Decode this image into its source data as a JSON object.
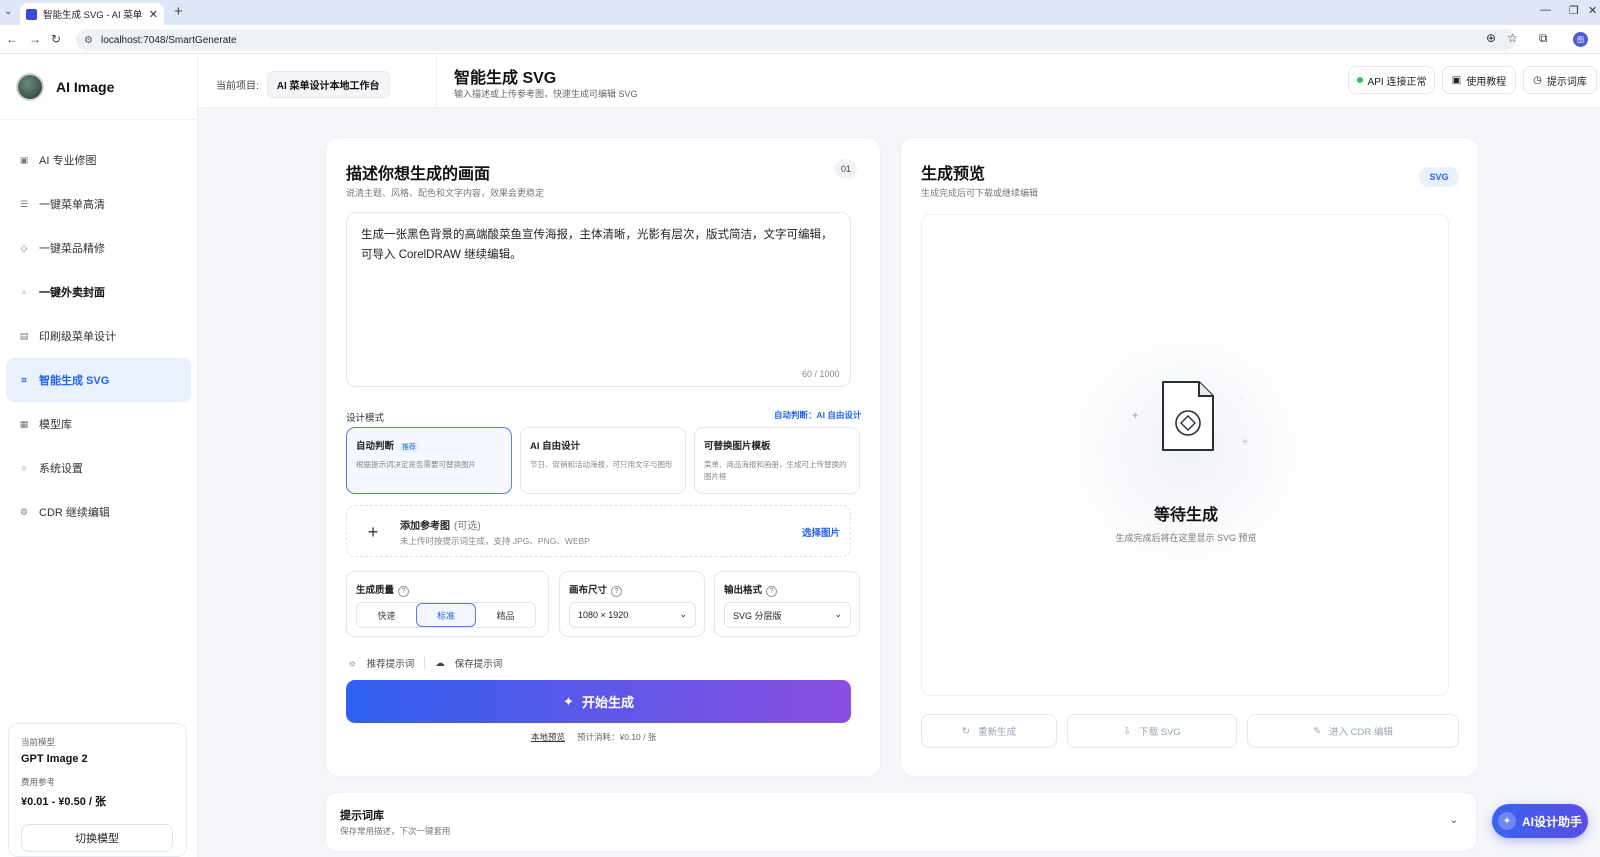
{
  "browser": {
    "tab_title": "智能生成 SVG - AI 菜单设计工",
    "url": "localhost:7048/SmartGenerate",
    "profile_initial": "图"
  },
  "sidebar": {
    "brand": "AI Image",
    "items": [
      {
        "label": "AI 专业修图",
        "icon": "▣"
      },
      {
        "label": "一键菜单高清",
        "icon": "☰"
      },
      {
        "label": "一键菜品精修",
        "icon": "◇"
      },
      {
        "label": "一键外卖封面",
        "icon": "▫"
      },
      {
        "label": "印刷级菜单设计",
        "icon": "▤"
      },
      {
        "label": "智能生成 SVG",
        "icon": "⌗"
      },
      {
        "label": "模型库",
        "icon": "▦"
      },
      {
        "label": "系统设置",
        "icon": "○"
      },
      {
        "label": "CDR 继续编辑",
        "icon": "⚙"
      }
    ],
    "model": {
      "label": "当前模型",
      "name": "GPT Image 2",
      "cost_label": "费用参考",
      "cost": "¥0.01 - ¥0.50 / 张",
      "switch_button": "切换模型"
    }
  },
  "header": {
    "project_label": "当前项目:",
    "project_value": "AI 菜单设计本地工作台",
    "title": "智能生成 SVG",
    "subtitle": "输入描述或上传参考图，快速生成可编辑 SVG",
    "api_status": "API 连接正常",
    "tutorial": "使用教程",
    "prompt_lib": "提示词库",
    "status_color": "#22c55e"
  },
  "left_card": {
    "title": "描述你想生成的画面",
    "subtitle": "说清主题、风格、配色和文字内容，效果会更稳定",
    "step": "01",
    "prompt": "生成一张黑色背景的高端酸菜鱼宣传海报，主体清晰，光影有层次，版式简洁，文字可编辑，可导入 CorelDRAW 继续编辑。",
    "count": "60 / 1000",
    "mode_label": "设计模式",
    "auto_hint": "自动判断：AI 自由设计",
    "modes": [
      {
        "title": "自动判断",
        "tag": "推荐",
        "desc": "根据提示词决定是否需要可替换图片"
      },
      {
        "title": "AI 自由设计",
        "tag": "",
        "desc": "节日、促销和活动海报，可只用文字与图形"
      },
      {
        "title": "可替换图片模板",
        "tag": "",
        "desc": "菜单、商品海报和画册，生成可上传替换的图片框"
      }
    ],
    "reference": {
      "title": "添加参考图",
      "optional": "(可选)",
      "desc": "未上传时按提示词生成，支持 JPG、PNG、WEBP",
      "pick": "选择图片"
    },
    "quality": {
      "label": "生成质量",
      "options": [
        "快速",
        "标准",
        "精品"
      ],
      "selected": "标准"
    },
    "canvas": {
      "label": "画布尺寸",
      "value": "1080 × 1920"
    },
    "format": {
      "label": "输出格式",
      "value": "SVG 分层版"
    },
    "recommend": "推荐提示词",
    "save": "保存提示词",
    "generate": "开始生成",
    "local_preview": "本地预览",
    "estimate": "预计消耗：¥0.10 / 张"
  },
  "right_card": {
    "title": "生成预览",
    "subtitle": "生成完成后可下载或继续编辑",
    "badge": "SVG",
    "waiting": "等待生成",
    "waiting_desc": "生成完成后将在这里显示 SVG 预览",
    "regen": "重新生成",
    "download": "下载 SVG",
    "cdr": "进入 CDR 编辑"
  },
  "library": {
    "title": "提示词库",
    "desc": "保存常用描述，下次一键套用"
  },
  "assistant": {
    "label": "AI设计助手"
  }
}
